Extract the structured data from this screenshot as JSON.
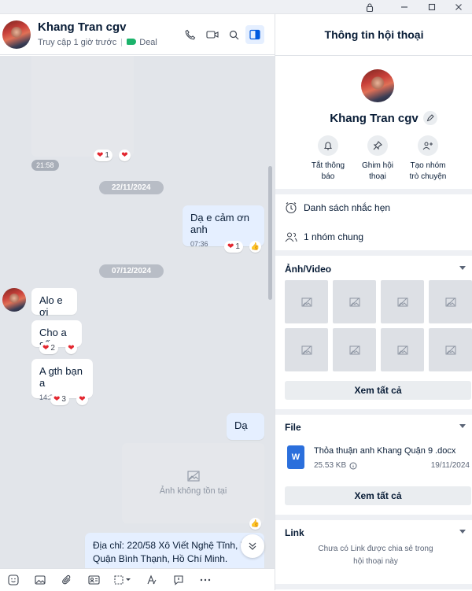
{
  "chat": {
    "contact_name": "Khang Tran cgv",
    "status": "Truy cập 1 giờ trước",
    "tag_label": "Deal",
    "tag_color": "#1bb36b",
    "messages": {
      "time_first": "21:58",
      "react_first_count": "1",
      "date1": "22/11/2024",
      "me_thanks": "Dạ e cảm ơn anh",
      "me_thanks_time": "07:36",
      "react_thanks_count": "1",
      "date2": "07/12/2024",
      "m1": "Alo e ơi",
      "m2": "Cho a số",
      "m2_react_count": "2",
      "m3": "A gth bạn a",
      "m3_time": "14:24",
      "m3_react_count": "3",
      "me_da": "Dạ",
      "missing_image": "Ảnh không tồn tại",
      "address_line1": "Địa chỉ: 220/58 Xô Viết Nghệ Tĩnh, P2",
      "address_line2": "Quận Bình Thạnh, Hồ Chí Minh."
    }
  },
  "panel": {
    "title": "Thông tin hội thoại",
    "name": "Khang Tran cgv",
    "actions": [
      {
        "label_1": "Tắt thông",
        "label_2": "báo"
      },
      {
        "label_1": "Ghim hội",
        "label_2": "thoại"
      },
      {
        "label_1": "Tạo nhóm",
        "label_2": "trò chuyện"
      }
    ],
    "reminder": "Danh sách nhắc hẹn",
    "groups": "1 nhóm chung",
    "media_title": "Ảnh/Video",
    "see_all": "Xem tất cả",
    "file_title": "File",
    "file": {
      "name": "Thỏa thuận anh Khang Quận 9 .docx",
      "size": "25.53 KB",
      "date": "19/11/2024",
      "icon_letter": "W"
    },
    "link_title": "Link",
    "link_empty_1": "Chưa có Link được chia sẻ trong",
    "link_empty_2": "hội thoại này"
  },
  "colors": {
    "accent": "#005ae0",
    "heart": "#e3262f",
    "my_bubble": "#e5efff"
  }
}
